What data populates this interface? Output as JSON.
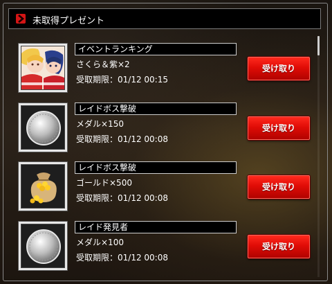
{
  "header": {
    "title": "未取得プレゼント",
    "icon": "chevron-right-icon"
  },
  "presents": [
    {
      "title": "イベントランキング",
      "reward": "さくら＆紫×2",
      "deadline": "受取期限：01/12 00:15",
      "button": "受け取り",
      "icon": "character-card-icon"
    },
    {
      "title": "レイドボス撃破",
      "reward": "メダル×150",
      "deadline": "受取期限：01/12 00:08",
      "button": "受け取り",
      "icon": "medal-icon"
    },
    {
      "title": "レイドボス撃破",
      "reward": "ゴールド×500",
      "deadline": "受取期限：01/12 00:08",
      "button": "受け取り",
      "icon": "gold-bag-icon"
    },
    {
      "title": "レイド発見者",
      "reward": "メダル×100",
      "deadline": "受取期限：01/12 00:08",
      "button": "受け取り",
      "icon": "medal-icon"
    }
  ],
  "colors": {
    "accent": "#d31515",
    "button": "#e00c06",
    "background": "#1b140e"
  }
}
